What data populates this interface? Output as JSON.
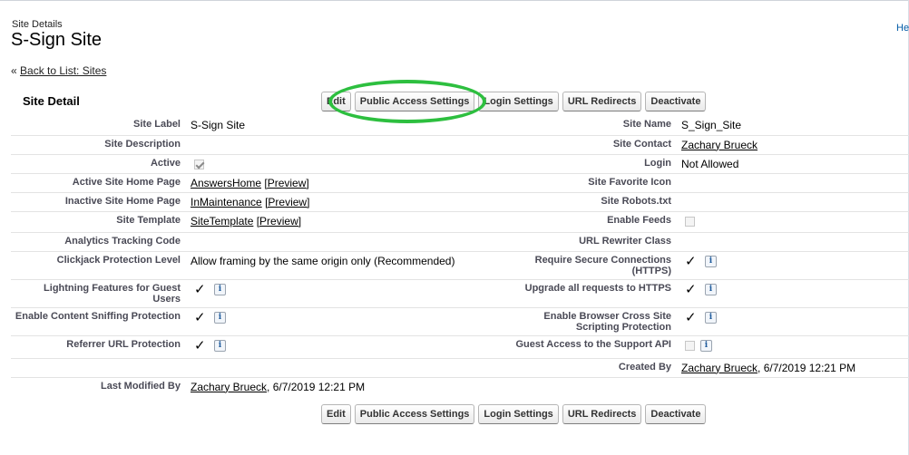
{
  "header": {
    "page_type": "Site Details",
    "title": "S-Sign Site",
    "help": "He",
    "back_prefix": "« ",
    "back_link": "Back to List: Sites"
  },
  "section": {
    "title": "Site Detail"
  },
  "buttons": {
    "edit": "Edit",
    "public_access": "Public Access Settings",
    "login_settings": "Login Settings",
    "url_redirects": "URL Redirects",
    "deactivate": "Deactivate"
  },
  "fields": {
    "site_label": {
      "label": "Site Label",
      "value": "S-Sign Site"
    },
    "site_name": {
      "label": "Site Name",
      "value": "S_Sign_Site"
    },
    "site_description": {
      "label": "Site Description",
      "value": ""
    },
    "site_contact": {
      "label": "Site Contact",
      "value": "Zachary Brueck"
    },
    "active": {
      "label": "Active",
      "checked": true
    },
    "login": {
      "label": "Login",
      "value": "Not Allowed"
    },
    "active_home": {
      "label": "Active Site Home Page",
      "value": "AnswersHome",
      "preview": "[Preview]"
    },
    "favorite_icon": {
      "label": "Site Favorite Icon",
      "value": ""
    },
    "inactive_home": {
      "label": "Inactive Site Home Page",
      "value": "InMaintenance",
      "preview": "[Preview]"
    },
    "robots": {
      "label": "Site Robots.txt",
      "value": ""
    },
    "template": {
      "label": "Site Template",
      "value": "SiteTemplate",
      "preview": "[Preview]"
    },
    "enable_feeds": {
      "label": "Enable Feeds",
      "checked": false
    },
    "analytics": {
      "label": "Analytics Tracking Code",
      "value": ""
    },
    "url_rewriter": {
      "label": "URL Rewriter Class",
      "value": ""
    },
    "clickjack": {
      "label": "Clickjack Protection Level",
      "value": "Allow framing by the same origin only (Recommended)"
    },
    "secure_connections": {
      "label_line1": "Require Secure Connections",
      "label_line2": "(HTTPS)",
      "checked": true
    },
    "lightning_guest": {
      "label": "Lightning Features for Guest Users",
      "checked": true
    },
    "upgrade_https": {
      "label": "Upgrade all requests to HTTPS",
      "checked": true
    },
    "content_sniffing": {
      "label": "Enable Content Sniffing Protection",
      "checked": true
    },
    "xss": {
      "label_line1": "Enable Browser Cross Site",
      "label_line2": "Scripting Protection",
      "checked": true
    },
    "referrer": {
      "label": "Referrer URL Protection",
      "checked": true
    },
    "guest_support_api": {
      "label": "Guest Access to the Support API",
      "checked": false
    },
    "created_by": {
      "label": "Created By",
      "user": "Zachary Brueck",
      "date": ", 6/7/2019 12:21 PM"
    },
    "modified_by": {
      "label": "Last Modified By",
      "user": "Zachary Brueck",
      "date": ", 6/7/2019 12:21 PM"
    }
  },
  "icons": {
    "check": "✓",
    "info": "i"
  },
  "colors": {
    "highlight": "#2dbf3f",
    "link": "#015ba7",
    "label": "#4a4a56"
  }
}
